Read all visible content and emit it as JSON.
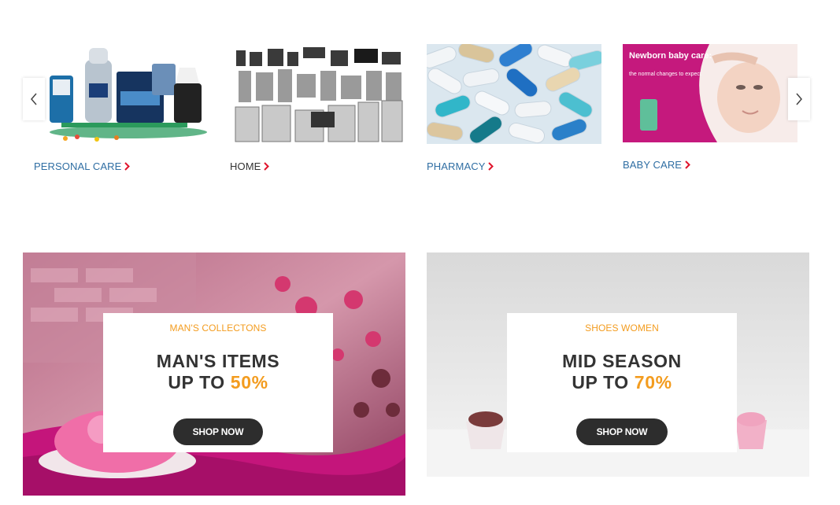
{
  "carousel": {
    "prev_icon": "chevron-left-icon",
    "next_icon": "chevron-right-icon",
    "categories": [
      {
        "label": "PERSONAL CARE",
        "color": "#2f6ea3"
      },
      {
        "label": "HOME",
        "color": "#333333"
      },
      {
        "label": "PHARMACY",
        "color": "#2f6ea3"
      },
      {
        "label": "BABY CARE",
        "color": "#2f6ea3",
        "image_text": {
          "title": "Newborn baby care:",
          "sub": "the normal changes to expect"
        }
      }
    ],
    "arrow_color": "#e0142c"
  },
  "banners": [
    {
      "kicker": "MAN'S COLLECTONS",
      "line1": "MAN'S ITEMS",
      "line2_prefix": "UP TO ",
      "line2_pct": "50%",
      "button": "SHOP NOW"
    },
    {
      "kicker": "SHOES WOMEN",
      "line1": "MID SEASON",
      "line2_prefix": "UP TO ",
      "line2_pct": "70%",
      "button": "SHOP NOW"
    }
  ],
  "colors": {
    "accent": "#f39c1f",
    "button_bg": "#2d2d2d",
    "link_blue": "#2f6ea3",
    "chevron_red": "#e0142c"
  }
}
